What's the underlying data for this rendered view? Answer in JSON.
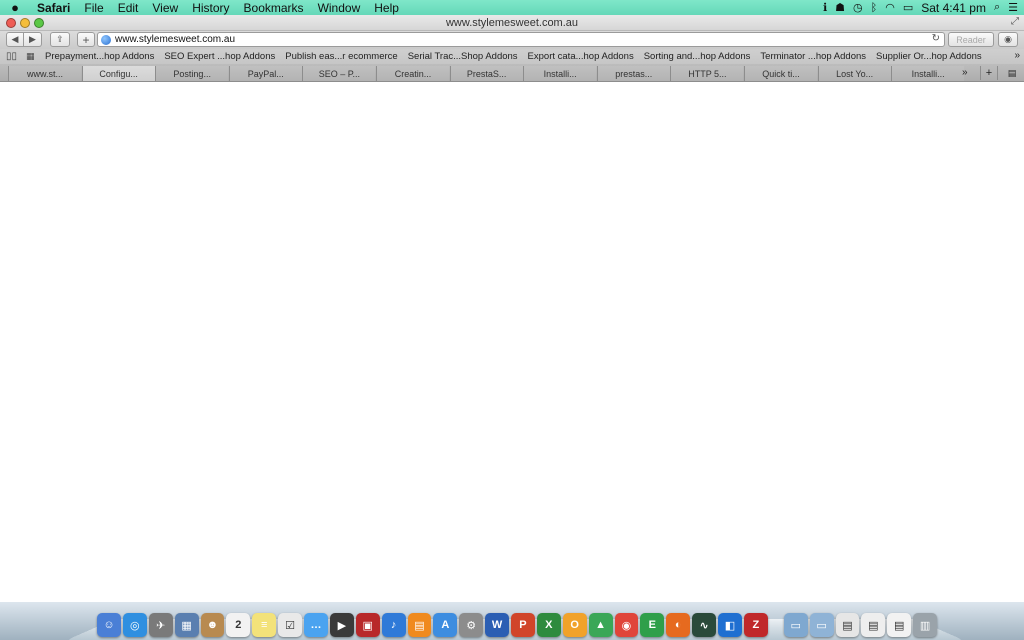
{
  "menubar": {
    "app": "Safari",
    "items": [
      "File",
      "Edit",
      "View",
      "History",
      "Bookmarks",
      "Window",
      "Help"
    ],
    "clock": "Sat 4:41 pm"
  },
  "window": {
    "title": "www.stylemesweet.com.au"
  },
  "toolbar": {
    "url": "www.stylemesweet.com.au",
    "reader_label": "Reader"
  },
  "bookmarks": [
    "Prepayment...hop Addons",
    "SEO Expert ...hop Addons",
    "Publish eas...r ecommerce",
    "Serial Trac...Shop Addons",
    "Export cata...hop Addons",
    "Sorting and...hop Addons",
    "Terminator ...hop Addons",
    "Supplier Or...hop Addons"
  ],
  "tabs": [
    "www.st...",
    "Configu...",
    "Posting...",
    "PayPal...",
    "SEO – P...",
    "Creatin...",
    "PrestaS...",
    "Installi...",
    "prestas...",
    "HTTP 5...",
    "Quick ti...",
    "Lost Yo...",
    "Installi..."
  ],
  "active_tab_index": 1,
  "dock": [
    {
      "name": "finder",
      "color": "#4a7fd6",
      "glyph": "☺"
    },
    {
      "name": "safari",
      "color": "#2f8fe0",
      "glyph": "◎"
    },
    {
      "name": "launchpad",
      "color": "#7a7a7a",
      "glyph": "✈"
    },
    {
      "name": "preview",
      "color": "#5a7fb0",
      "glyph": "▦"
    },
    {
      "name": "contacts",
      "color": "#b88a50",
      "glyph": "☻"
    },
    {
      "name": "calendar",
      "color": "#f2f2f2",
      "glyph": "2"
    },
    {
      "name": "notes",
      "color": "#f3e27a",
      "glyph": "≡"
    },
    {
      "name": "reminders",
      "color": "#e9e9e9",
      "glyph": "☑"
    },
    {
      "name": "messages",
      "color": "#4aa3f0",
      "glyph": "…"
    },
    {
      "name": "facetime",
      "color": "#3a3a3a",
      "glyph": "▶"
    },
    {
      "name": "photo-booth",
      "color": "#b8282a",
      "glyph": "▣"
    },
    {
      "name": "itunes",
      "color": "#2f7ad8",
      "glyph": "♪"
    },
    {
      "name": "ibooks",
      "color": "#f08a1e",
      "glyph": "▤"
    },
    {
      "name": "app-store",
      "color": "#3d8de0",
      "glyph": "A"
    },
    {
      "name": "system-preferences",
      "color": "#8c8c8c",
      "glyph": "⚙"
    },
    {
      "name": "word",
      "color": "#2b5eb3",
      "glyph": "W"
    },
    {
      "name": "powerpoint",
      "color": "#d1452a",
      "glyph": "P"
    },
    {
      "name": "excel",
      "color": "#2e8b3e",
      "glyph": "X"
    },
    {
      "name": "outlook",
      "color": "#f1a22a",
      "glyph": "O"
    },
    {
      "name": "google-drive",
      "color": "#3aa757",
      "glyph": "▲"
    },
    {
      "name": "chrome",
      "color": "#e0453a",
      "glyph": "◉"
    },
    {
      "name": "evernote",
      "color": "#2f9f4a",
      "glyph": "E"
    },
    {
      "name": "firefox",
      "color": "#e66a1f",
      "glyph": "◐"
    },
    {
      "name": "activity-monitor",
      "color": "#2a4a3a",
      "glyph": "∿"
    },
    {
      "name": "sourcetree",
      "color": "#1f6fd1",
      "glyph": "◧"
    },
    {
      "name": "filezilla",
      "color": "#c0282a",
      "glyph": "Z"
    },
    {
      "name": "applications-folder",
      "color": "#7fa8d0",
      "glyph": "▭"
    },
    {
      "name": "documents-folder",
      "color": "#8fb3d6",
      "glyph": "▭"
    },
    {
      "name": "downloads-stack",
      "color": "#e6e6e6",
      "glyph": "▤"
    },
    {
      "name": "stack-2",
      "color": "#eeeeee",
      "glyph": "▤"
    },
    {
      "name": "stack-3",
      "color": "#f2f2f2",
      "glyph": "▤"
    },
    {
      "name": "trash",
      "color": "#9aa3aa",
      "glyph": "▥"
    }
  ]
}
